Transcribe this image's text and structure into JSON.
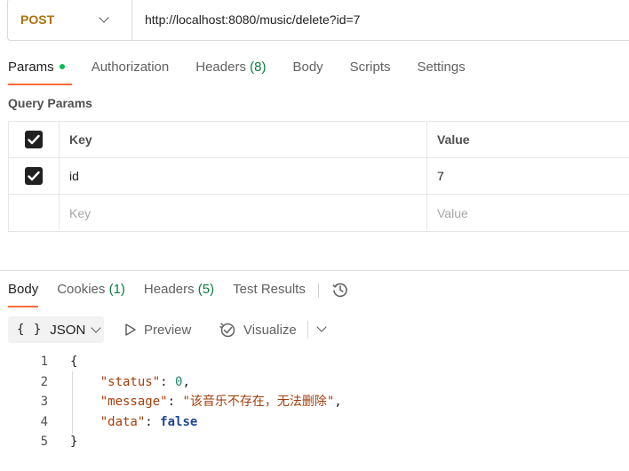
{
  "request": {
    "method": "POST",
    "url": "http://localhost:8080/music/delete?id=7"
  },
  "request_tabs": [
    {
      "label": "Params",
      "active": true,
      "dot": true
    },
    {
      "label": "Authorization"
    },
    {
      "label": "Headers",
      "count": "(8)"
    },
    {
      "label": "Body"
    },
    {
      "label": "Scripts"
    },
    {
      "label": "Settings"
    }
  ],
  "query_params": {
    "title": "Query Params",
    "header": {
      "key": "Key",
      "value": "Value"
    },
    "rows": [
      {
        "key": "id",
        "value": "7",
        "checked": true
      }
    ],
    "placeholder": {
      "key": "Key",
      "value": "Value"
    }
  },
  "response_tabs": [
    {
      "label": "Body",
      "active": true
    },
    {
      "label": "Cookies",
      "count": "(1)"
    },
    {
      "label": "Headers",
      "count": "(5)"
    },
    {
      "label": "Test Results"
    }
  ],
  "response_toolbar": {
    "format_icon": "{ }",
    "format": "JSON",
    "preview": "Preview",
    "visualize": "Visualize"
  },
  "response_body": {
    "line_numbers": [
      "1",
      "2",
      "3",
      "4",
      "5"
    ],
    "open_brace": "{",
    "close_brace": "}",
    "fields": [
      {
        "key": "\"status\"",
        "value": "0",
        "type": "number",
        "comma": ","
      },
      {
        "key": "\"message\"",
        "value": "\"该音乐不存在，无法删除\"",
        "type": "string",
        "comma": ","
      },
      {
        "key": "\"data\"",
        "value": "false",
        "type": "boolean",
        "comma": ""
      }
    ]
  },
  "colors": {
    "method": "#a8740b",
    "active_tab_underline": "#ff6c37",
    "count": "#0a7c42",
    "status_dot": "#0cbb52"
  }
}
